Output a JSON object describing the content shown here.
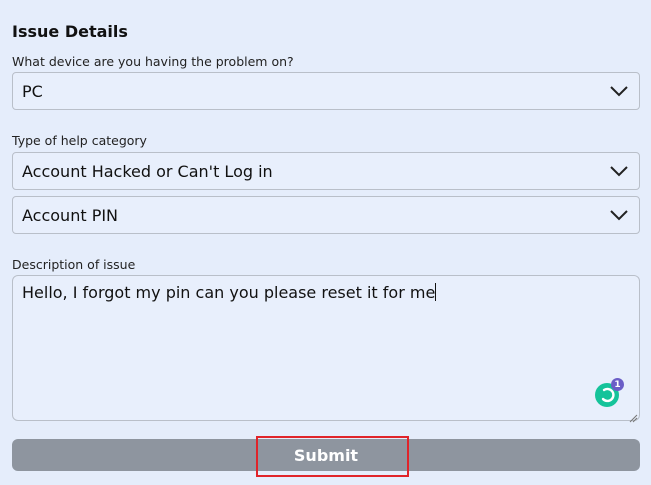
{
  "issue_details": {
    "title": "Issue Details",
    "device": {
      "label": "What device are you having the problem on?",
      "selected": "PC"
    },
    "category": {
      "label": "Type of help category",
      "selected": "Account Hacked or Can't Log in",
      "subcategory": "Account PIN"
    },
    "description": {
      "label": "Description of issue",
      "value": "Hello, I forgot my pin can you please reset it for me"
    },
    "grammar_badge_count": "1",
    "submit_label": "Submit"
  },
  "colors": {
    "background": "#e5edfb",
    "submit_disabled": "#8e959f",
    "highlight": "#e0242a",
    "grammar_icon": "#15c39a",
    "badge": "#6b5ec7"
  },
  "icons": {
    "dropdown": "chevron-down-icon",
    "grammar": "grammarly-icon",
    "resize": "resize-handle-icon"
  }
}
